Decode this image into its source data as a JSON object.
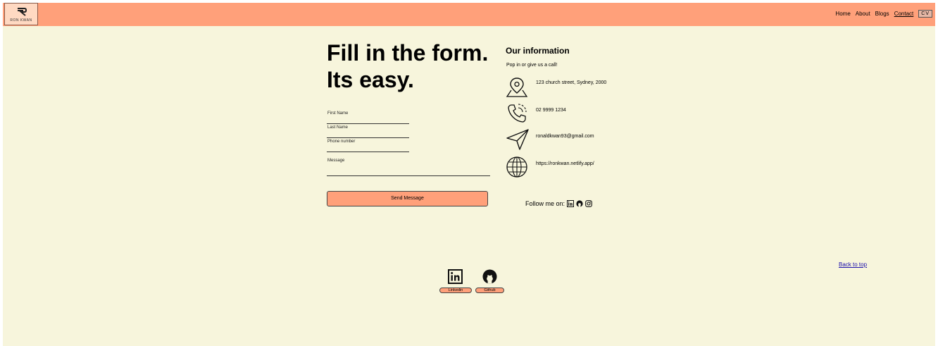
{
  "navbar": {
    "logo_text": "RON KWAN",
    "links": [
      {
        "label": "Home"
      },
      {
        "label": "About"
      },
      {
        "label": "Blogs"
      },
      {
        "label": "Contact"
      }
    ],
    "cv_label": "CV"
  },
  "form": {
    "headline_line1": "Fill in the form.",
    "headline_line2": "Its easy.",
    "fields": {
      "first_name": "First Name",
      "last_name": "Last Name",
      "phone": "Phone number",
      "message": "Message"
    },
    "send_label": "Send Message"
  },
  "info": {
    "title": "Our information",
    "subtitle": "Pop in or give us a call!",
    "address": "123 church street, Sydney, 2000",
    "phone": "02 9999 1234",
    "email": "ronaldkwan93@gmail.com",
    "website": "https://ronkwan.netlify.app/",
    "follow_label": "Follow me on:"
  },
  "footer": {
    "back_to_top": "Back to top",
    "linkedin_label": "Linkedin",
    "github_label": "Github"
  }
}
